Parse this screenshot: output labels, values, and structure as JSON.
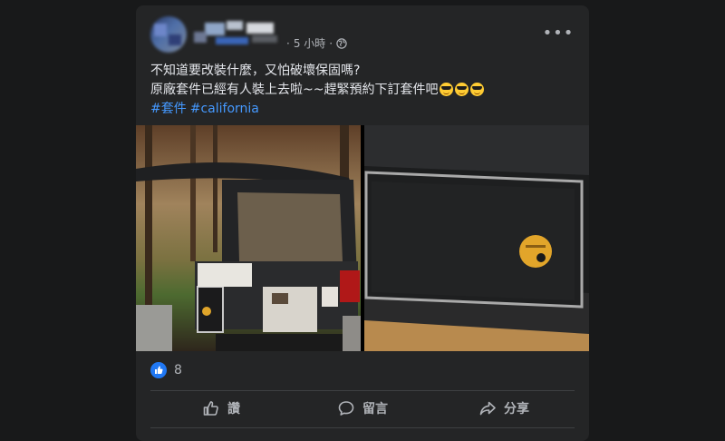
{
  "post": {
    "time": "5 小時",
    "separator": "·",
    "text_line1": "不知道要改裝什麼，又怕破壞保固嗎?",
    "text_line2": "原廠套件已經有人裝上去啦~~趕緊預約下訂套件吧",
    "emoji_icons": [
      "sunglasses-emoji",
      "sunglasses-emoji",
      "sunglasses-emoji"
    ],
    "hashtags": [
      "#套件",
      "#california"
    ]
  },
  "reactions": {
    "icon": "like-icon",
    "count": "8"
  },
  "actions": {
    "like_label": "讚",
    "comment_label": "留言",
    "share_label": "分享"
  },
  "colors": {
    "background": "#18191a",
    "card": "#242526",
    "text": "#e4e6eb",
    "muted": "#b0b3b8",
    "link": "#4599ff",
    "like_blue": "#2078f4"
  }
}
